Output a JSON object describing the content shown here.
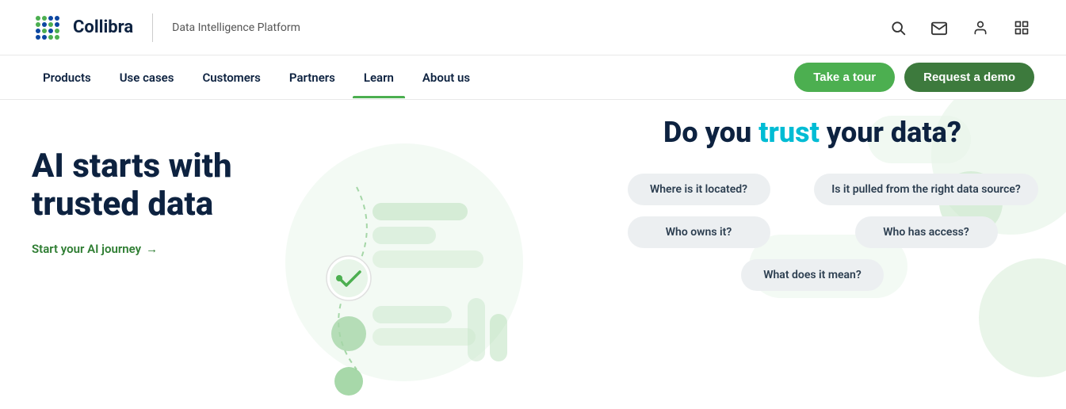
{
  "brand": {
    "logo_alt": "Collibra logo",
    "name": "Collibra",
    "platform": "Data Intelligence Platform"
  },
  "topIcons": [
    {
      "name": "search-icon",
      "symbol": "🔍"
    },
    {
      "name": "mail-icon",
      "symbol": "✉"
    },
    {
      "name": "user-icon",
      "symbol": "👤"
    },
    {
      "name": "grid-icon",
      "symbol": "⊞"
    }
  ],
  "nav": {
    "links": [
      {
        "id": "products",
        "label": "Products",
        "active": false
      },
      {
        "id": "use-cases",
        "label": "Use cases",
        "active": false
      },
      {
        "id": "customers",
        "label": "Customers",
        "active": false
      },
      {
        "id": "partners",
        "label": "Partners",
        "active": false
      },
      {
        "id": "learn",
        "label": "Learn",
        "active": true
      },
      {
        "id": "about",
        "label": "About us",
        "active": false
      }
    ],
    "cta_tour": "Take a tour",
    "cta_demo": "Request a demo"
  },
  "hero": {
    "title_line1": "AI starts with",
    "title_line2": "trusted data",
    "cta_link": "Start your AI journey",
    "question_heading_pre": "Do you ",
    "question_heading_highlight": "trust",
    "question_heading_post": " your data?",
    "pills": [
      {
        "id": "where",
        "label": "Where is it located?",
        "wide": false
      },
      {
        "id": "pulled",
        "label": "Is it pulled from the right data source?",
        "wide": false
      },
      {
        "id": "owns",
        "label": "Who owns it?",
        "wide": false
      },
      {
        "id": "access",
        "label": "Who has access?",
        "wide": false
      },
      {
        "id": "mean",
        "label": "What does it mean?",
        "wide": true
      }
    ]
  }
}
